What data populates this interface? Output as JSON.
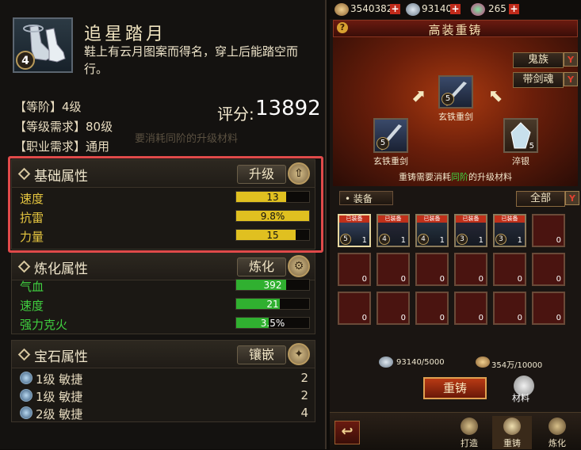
{
  "item": {
    "level": "4",
    "name": "追星踏月",
    "description": "鞋上有云月图案而得名，穿上后能踏空而行。",
    "tier": "【等阶】4级",
    "level_req": "【等级需求】80级",
    "job_req": "【职业需求】通用",
    "score_label": "评分:",
    "score": "13892",
    "ghost_text": "要消耗同阶的升级材料"
  },
  "base_attrs": {
    "title": "基础属性",
    "button": "升级",
    "button_icon": "⇧",
    "rows": [
      {
        "name": "速度",
        "value": "13",
        "fill": 0.68
      },
      {
        "name": "抗雷",
        "value": "9.8%",
        "fill": 1.0
      },
      {
        "name": "力量",
        "value": "15",
        "fill": 0.82
      }
    ],
    "color": "#e0c020"
  },
  "refine_attrs": {
    "title": "炼化属性",
    "button": "炼化",
    "button_icon": "⚙",
    "rows": [
      {
        "name": "气血",
        "value": "392",
        "fill": 0.68
      },
      {
        "name": "速度",
        "value": "21",
        "fill": 0.6
      },
      {
        "name": "强力克火",
        "value": "3.5%",
        "fill": 0.45
      }
    ],
    "color": "#30b030"
  },
  "gem_attrs": {
    "title": "宝石属性",
    "button": "镶嵌",
    "button_icon": "✦",
    "rows": [
      {
        "text": "1级  敏捷",
        "count": "2"
      },
      {
        "text": "1级  敏捷",
        "count": "2"
      },
      {
        "text": "2级  敏捷",
        "count": "4"
      }
    ]
  },
  "resources": {
    "silver": "3540382",
    "gold": "93140",
    "gem": "265"
  },
  "forge": {
    "title": "高装重铸",
    "help": "?",
    "filter1": "鬼族",
    "filter2": "带剑魂",
    "target": {
      "name": "玄铁重剑",
      "level": "5"
    },
    "src1": {
      "name": "玄铁重剑",
      "level": "5"
    },
    "src2": {
      "name": "淬银",
      "count": "5"
    },
    "hint_pre": "重铸需要消耗",
    "hint_green": "同阶",
    "hint_post": "的升级材料"
  },
  "equip": {
    "label": "装备",
    "filter": "全部",
    "tag_text": "已装备",
    "cells": [
      {
        "lv": "5",
        "c": "1",
        "tag": true
      },
      {
        "lv": "4",
        "c": "1",
        "tag": true
      },
      {
        "lv": "4",
        "c": "1",
        "tag": true
      },
      {
        "lv": "3",
        "c": "1",
        "tag": true
      },
      {
        "lv": "3",
        "c": "1",
        "tag": true
      },
      {
        "lv": "",
        "c": "0",
        "tag": false
      },
      {
        "lv": "",
        "c": "0",
        "tag": false
      },
      {
        "lv": "",
        "c": "0",
        "tag": false
      },
      {
        "lv": "",
        "c": "0",
        "tag": false
      },
      {
        "lv": "",
        "c": "0",
        "tag": false
      },
      {
        "lv": "",
        "c": "0",
        "tag": false
      },
      {
        "lv": "",
        "c": "0",
        "tag": false
      },
      {
        "lv": "",
        "c": "0",
        "tag": false
      },
      {
        "lv": "",
        "c": "0",
        "tag": false
      },
      {
        "lv": "",
        "c": "0",
        "tag": false
      },
      {
        "lv": "",
        "c": "0",
        "tag": false
      },
      {
        "lv": "",
        "c": "0",
        "tag": false
      },
      {
        "lv": "",
        "c": "0",
        "tag": false
      }
    ]
  },
  "costs": {
    "silver": "93140/5000",
    "gold": "354万/10000"
  },
  "actions": {
    "recast": "重铸",
    "material": "材料"
  },
  "tabs": [
    {
      "label": "打造",
      "icon": "hammer-icon"
    },
    {
      "label": "重铸",
      "icon": "anvil-icon"
    },
    {
      "label": "炼化",
      "icon": "furnace-icon"
    }
  ],
  "back_icon": "↩"
}
